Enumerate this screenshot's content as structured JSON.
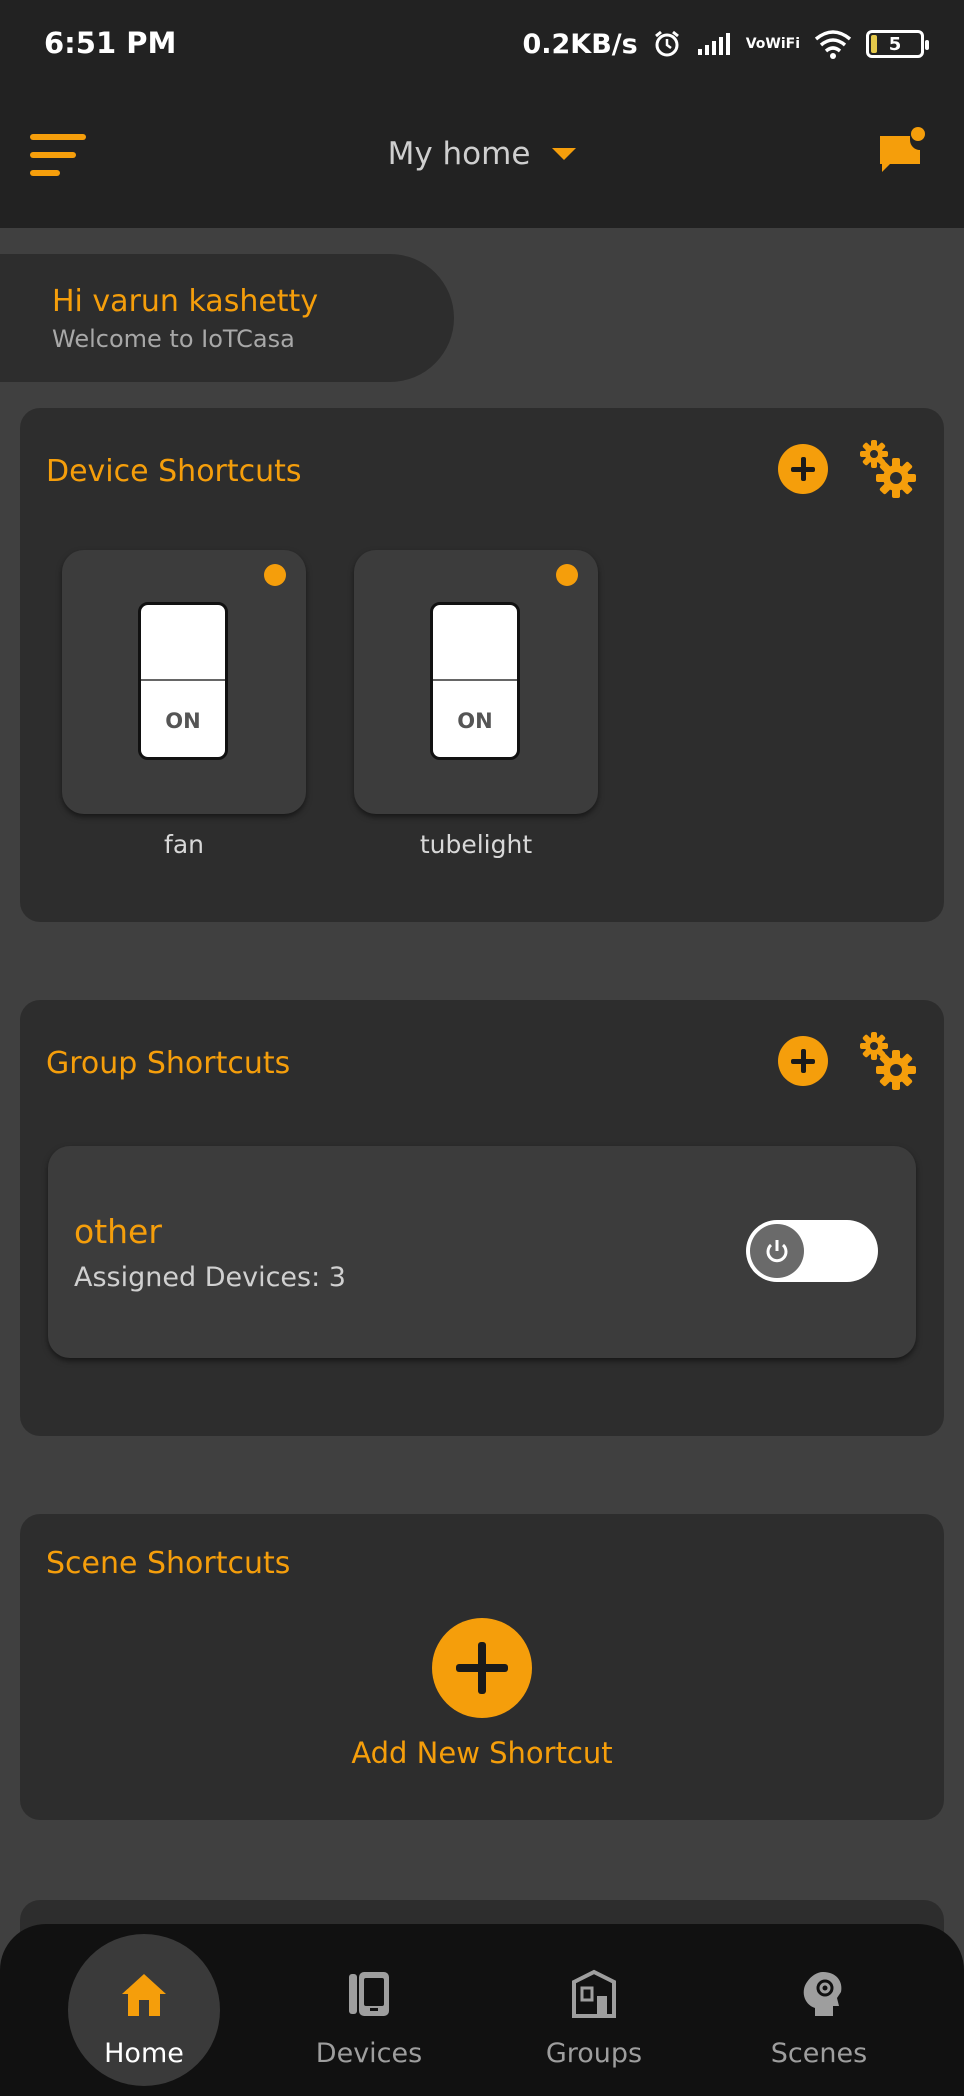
{
  "status_bar": {
    "time": "6:51 PM",
    "net_speed": "0.2KB/s",
    "vowifi_top": "Vo",
    "vowifi_bottom": "WiFi",
    "battery_level": "5"
  },
  "app_bar": {
    "home_name": "My home",
    "menu_icon": "menu-icon",
    "message_icon": "message-alert-icon"
  },
  "greeting": {
    "title": "Hi varun kashetty",
    "subtitle": "Welcome to IoTCasa"
  },
  "device_shortcuts": {
    "title": "Device Shortcuts",
    "devices": [
      {
        "name": "fan",
        "state": "ON"
      },
      {
        "name": "tubelight",
        "state": "ON"
      }
    ]
  },
  "group_shortcuts": {
    "title": "Group Shortcuts",
    "groups": [
      {
        "name": "other",
        "assigned": "Assigned Devices: 3",
        "power": "off"
      }
    ]
  },
  "scene_shortcuts": {
    "title": "Scene Shortcuts",
    "add_label": "Add New Shortcut"
  },
  "bottom_nav": {
    "items": [
      {
        "label": "Home",
        "icon": "home-icon",
        "active": true
      },
      {
        "label": "Devices",
        "icon": "devices-icon",
        "active": false
      },
      {
        "label": "Groups",
        "icon": "groups-icon",
        "active": false
      },
      {
        "label": "Scenes",
        "icon": "scenes-icon",
        "active": false
      }
    ]
  },
  "colors": {
    "accent": "#f59e0b",
    "background": "#404040",
    "card": "#2d2d2d",
    "nav": "#111111"
  }
}
